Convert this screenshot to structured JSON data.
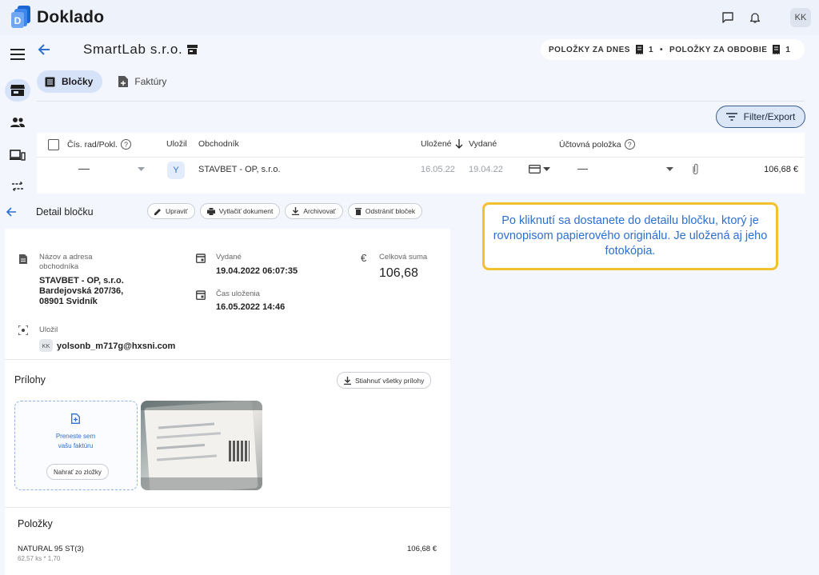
{
  "app": {
    "name": "Doklado",
    "user_initials": "KK"
  },
  "company": {
    "name": "SmartLab s.r.o."
  },
  "stats": {
    "today_label": "POLOŽKY ZA DNES",
    "today_count": "1",
    "period_label": "POLOŽKY ZA OBDOBIE",
    "period_count": "1",
    "separator": "•"
  },
  "tabs": [
    {
      "label": "Bločky",
      "active": true
    },
    {
      "label": "Faktúry",
      "active": false
    }
  ],
  "filter_button": "Filter/Export",
  "table": {
    "headers": {
      "number": "Čís. rad/Pokl.",
      "saved_by": "Uložil",
      "merchant": "Obchodník",
      "saved": "Uložené",
      "issued": "Vydané",
      "account_item": "Účtovná položka"
    },
    "rows": [
      {
        "number": "—",
        "saved_by": "Y",
        "merchant": "STAVBET - OP, s.r.o.",
        "saved": "16.05.22",
        "issued": "19.04.22",
        "account_item": "—",
        "amount": "106,68 €"
      }
    ]
  },
  "detail": {
    "back_title": "Detail bločku",
    "actions": [
      "Upraviť",
      "Vytlačiť dokument",
      "Archivovať",
      "Odstrániť bloček"
    ],
    "merchant_label": "Názov a adresa obchodníka",
    "merchant_lines": [
      "STAVBET - OP, s.r.o.",
      "Bardejovská 207/36,",
      "08901 Svidník"
    ],
    "issued_label": "Vydané",
    "issued_value": "19.04.2022 06:07:35",
    "saved_time_label": "Čas uloženia",
    "saved_time_value": "16.05.2022 14:46",
    "total_label": "Celková suma",
    "total_value": "106,68",
    "currency_symbol": "€",
    "saved_by_label": "Uložil",
    "saved_by_initials": "KK",
    "saved_by_email": "yolsonb_m717g@hxsni.com",
    "attachments_title": "Prílohy",
    "download_all": "Stiahnuť všetky prílohy",
    "drop_text_1": "Preneste sem",
    "drop_text_2": "vašu faktúru",
    "upload_button": "Nahrať zo zložky",
    "items_title": "Položky",
    "items": [
      {
        "name": "NATURAL 95 ST(3)",
        "detail": "62,57 ks * 1,70",
        "amount": "106,68 €"
      }
    ]
  },
  "callout": {
    "text": "Po kliknutí sa dostanete do detailu bločku, ktorý je rovnopisom papierového originálu. Je uložená aj jeho fotokópia."
  },
  "colors": {
    "accent": "#2d6fd1",
    "callout_border": "#f2c12e",
    "active_tab": "#d6e2f8",
    "background": "#f3f6fc"
  }
}
